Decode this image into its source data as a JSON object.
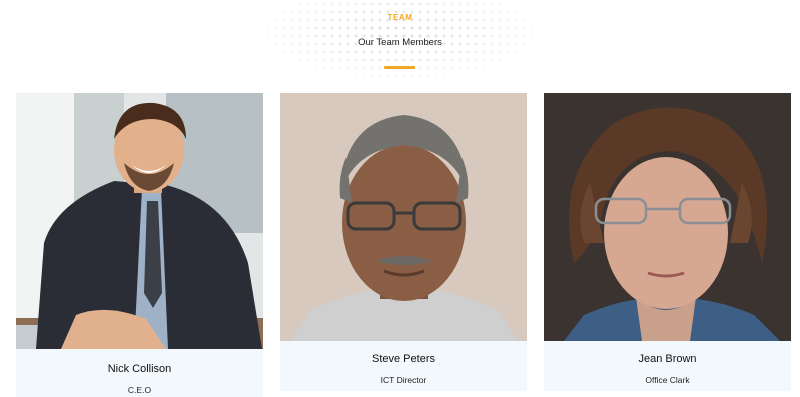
{
  "section": {
    "eyebrow": "TEAM",
    "title": "Our Team Members"
  },
  "members": [
    {
      "name": "Nick Collison",
      "role": "C.E.O"
    },
    {
      "name": "Steve Peters",
      "role": "ICT Director"
    },
    {
      "name": "Jean Brown",
      "role": "Office Clark"
    }
  ],
  "colors": {
    "accent": "#f0a828",
    "caption_bg": "#f3f8fc"
  }
}
